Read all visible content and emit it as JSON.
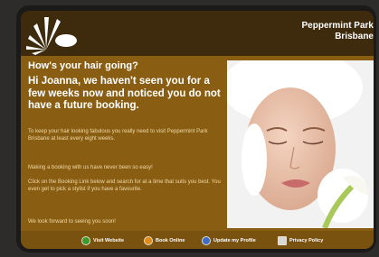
{
  "brand": {
    "line1": "Peppermint Park",
    "line2": "Brisbane"
  },
  "email": {
    "greeting": "How's your hair going?",
    "headline": "Hi Joanna, we haven't seen you for a few weeks now and noticed you do not have a future booking.",
    "paragraphs": [
      "To keep your hair looking fabulous you really need to visit Peppermint Park Brisbane at least every eight weeks.",
      "Making a booking with us have never been so easy!",
      "Click on the Booking Link below and search for at a time that suits you best. You even get to pick a stylist if you have a favourite.",
      "We look forward to seeing you soon!"
    ]
  },
  "footer": {
    "links": [
      {
        "label": "Visit Website",
        "icon": "globe-icon",
        "color": "#3a9a2a"
      },
      {
        "label": "Book Online",
        "icon": "calendar-icon",
        "color": "#e08a18"
      },
      {
        "label": "Update my Profile",
        "icon": "person-icon",
        "color": "#3a6cc8"
      },
      {
        "label": "Privacy Policy",
        "icon": "document-icon",
        "color": "#d8d8d8"
      }
    ]
  },
  "colors": {
    "card": "#8a5e12",
    "header": "#3e2a0c",
    "footer": "#7a5210"
  }
}
